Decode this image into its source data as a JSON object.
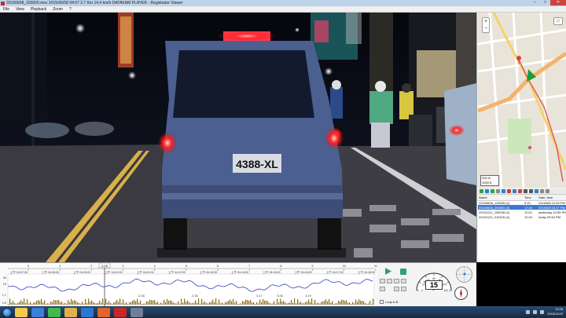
{
  "window": {
    "title": "20150608_200000.mov  2015/06/08 04:07  2.7 Km  14.4 km/h  DATAKAM PLAYER - Registrator Viewer",
    "min_label": "–",
    "max_label": "□",
    "close_label": "✕"
  },
  "menu": {
    "items": [
      "File",
      "View",
      "Playback",
      "Zoom",
      "?"
    ]
  },
  "video": {
    "license_plate": "4388-XL"
  },
  "map": {
    "zoom_in": "+",
    "zoom_out": "−",
    "layers_label": "◇",
    "scale_m": "200 m",
    "scale_ft": "1000 ft"
  },
  "file_list": {
    "columns": [
      "Name",
      "Time",
      "Date, time"
    ],
    "rows": [
      {
        "name": "20150608_110905 (4)",
        "time": "9:10",
        "date": "2015/6/8 10:09 PM",
        "selected": false
      },
      {
        "name": "20150608_200000 (4)",
        "time": "17:44",
        "date": "2015/6/8 04:07 PM",
        "selected": true
      },
      {
        "name": "20151121_105008 (4)",
        "time": "10:01",
        "date": "yesterday 10:55 PM",
        "selected": false
      },
      {
        "name": "20151121_210425 (4)",
        "time": "10:34",
        "date": "today 09:54 PM",
        "selected": false
      }
    ]
  },
  "timeline": {
    "minute_ticks": [
      "0",
      "1",
      "2",
      "3",
      "4",
      "5",
      "6",
      "7",
      "8",
      "9",
      "10",
      "11"
    ],
    "time_labels": [
      "上午 04:07:00",
      "上午 04:08:00",
      "上午 04:09:00",
      "上午 04:10:00",
      "上午 04:11:00",
      "上午 04:12:00",
      "上午 04:13:00",
      "上午 04:14:00",
      "上午 04:15:00",
      "上午 04:16:00",
      "上午 04:17:00",
      "上午 04:18:00"
    ],
    "cursor_label": "3.28",
    "y_labels": [
      "30",
      "15",
      "1.7",
      "0.5"
    ],
    "annotations": [
      "2.34",
      "2.30",
      "3.17",
      "3.06",
      "3.19"
    ]
  },
  "controls": {
    "speed": "15",
    "loop_label": "Loop A-B",
    "gauge_ticks": [
      "0",
      "20",
      "40",
      "60",
      "80",
      "100",
      "120"
    ]
  },
  "taskbar": {
    "time": "11:26",
    "date": "2015/11/22"
  },
  "colors": {
    "speed_line": "#2e3fc0",
    "accel_bars": "#8a6a1a",
    "selection": "#3a79d4",
    "map_route": "#e05a5a",
    "map_road": "#f4b26a"
  }
}
